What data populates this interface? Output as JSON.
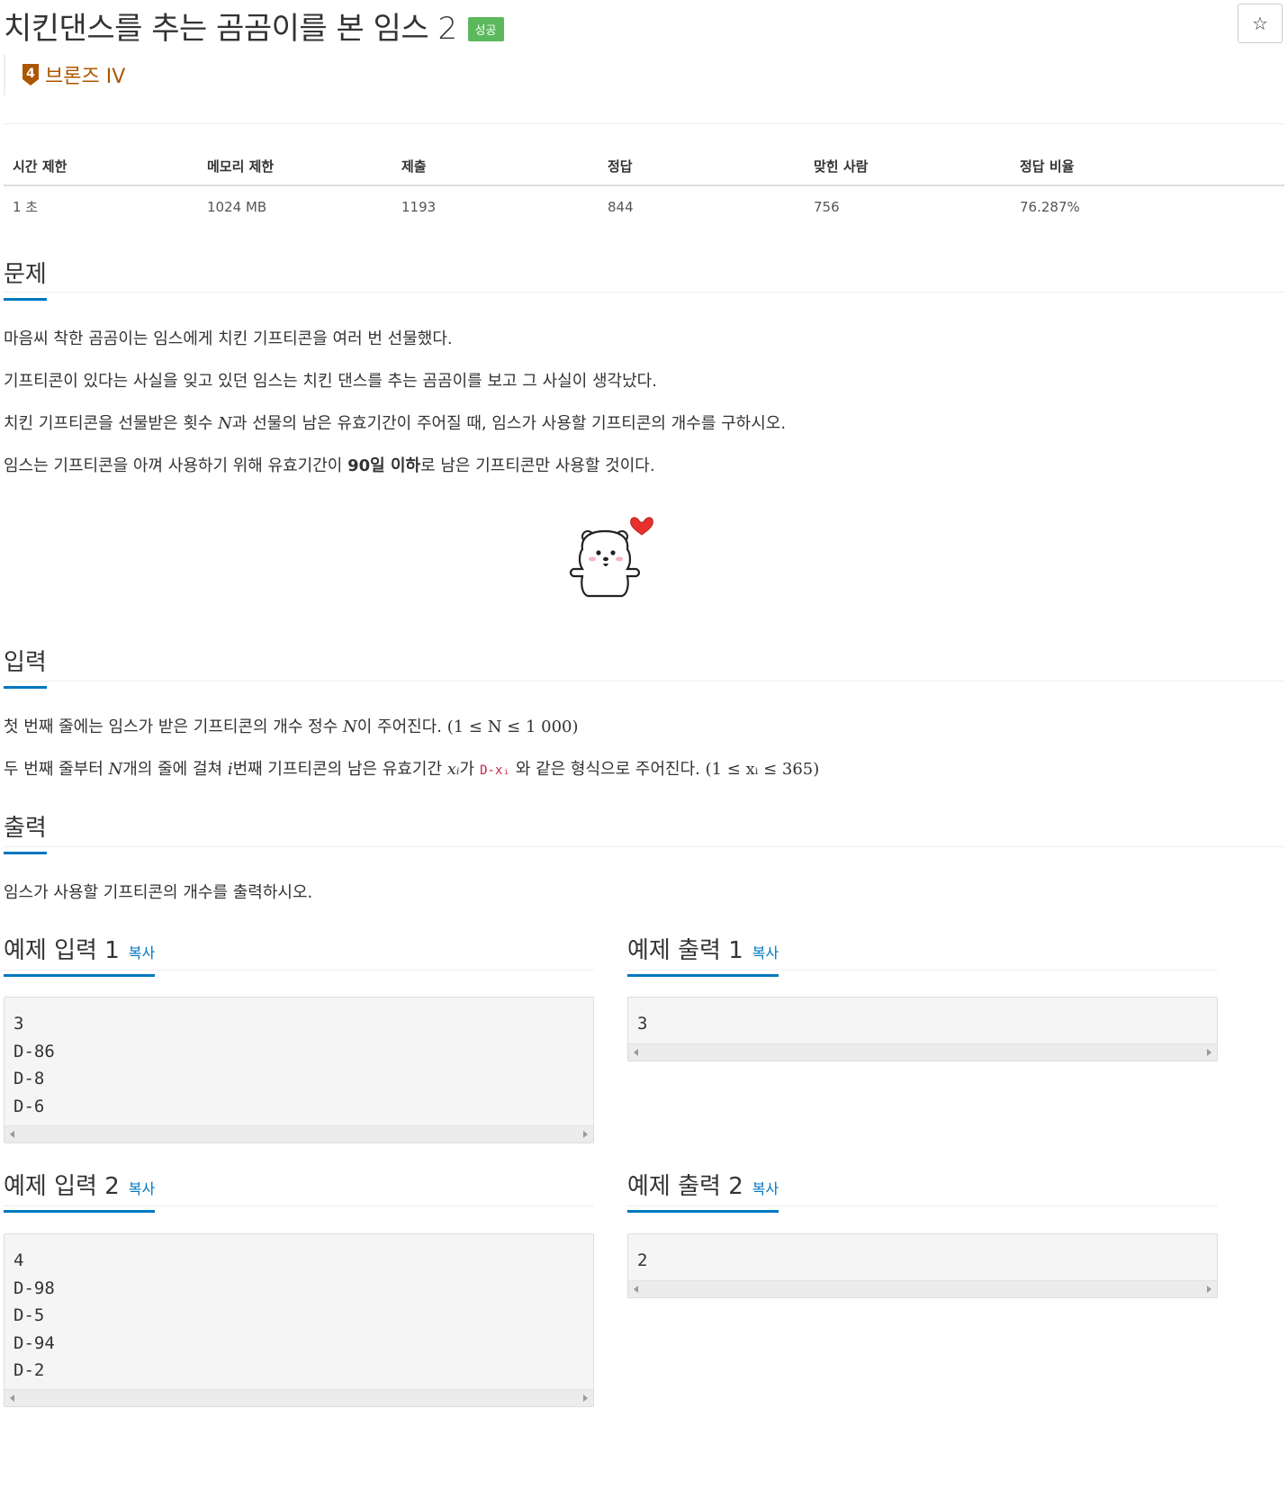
{
  "title": "치킨댄스를 추는 곰곰이를 본 임스 2",
  "result_badge": "성공",
  "star_glyph": "☆",
  "tier": {
    "level": "4",
    "label": "브론즈 IV",
    "color": "#ad5600"
  },
  "info_table": {
    "headers": [
      "시간 제한",
      "메모리 제한",
      "제출",
      "정답",
      "맞힌 사람",
      "정답 비율"
    ],
    "values": [
      "1 초",
      "1024 MB",
      "1193",
      "844",
      "756",
      "76.287%"
    ]
  },
  "problem": {
    "heading": "문제",
    "lines": [
      "마음씨 착한 곰곰이는 임스에게 치킨 기프티콘을 여러 번 선물했다.",
      "기프티콘이 있다는 사실을 잊고 있던 임스는 치킨 댄스를 추는 곰곰이를 보고 그 사실이 생각났다."
    ],
    "line3_a": "치킨 기프티콘을 선물받은 횟수 ",
    "line3_var": "N",
    "line3_b": "과 선물의 남은 유효기간이 주어질 때, 임스가 사용할 기프티콘의 개수를 구하시오.",
    "line4_a": "임스는 기프티콘을 아껴 사용하기 위해 유효기간이 ",
    "line4_bold": "90일 이하",
    "line4_b": "로 남은 기프티콘만 사용할 것이다."
  },
  "input": {
    "heading": "입력",
    "l1_a": "첫 번째 줄에는 임스가 받은 기프티콘의 개수 정수 ",
    "l1_var": "N",
    "l1_b": "이 주어진다. ",
    "l1_math": "(1 ≤ N ≤ 1 000)",
    "l2_a": "두 번째 줄부터 ",
    "l2_var1": "N",
    "l2_b": "개의 줄에 걸쳐 ",
    "l2_var2": "i",
    "l2_c": "번째 기프티콘의 남은 유효기간 ",
    "l2_var3": "xᵢ",
    "l2_d": "가",
    "l2_code": "D-xᵢ",
    "l2_e": "와 같은 형식으로 주어진다. ",
    "l2_math": "(1 ≤ xᵢ ≤ 365)"
  },
  "output": {
    "heading": "출력",
    "text": "임스가 사용할 기프티콘의 개수를 출력하시오."
  },
  "samples": {
    "copy_label": "복사",
    "in1": {
      "heading": "예제 입력 1",
      "lines": [
        "3",
        "D-86",
        "D-8",
        "D-6"
      ]
    },
    "out1": {
      "heading": "예제 출력 1",
      "lines": [
        "3"
      ]
    },
    "in2": {
      "heading": "예제 입력 2",
      "lines": [
        "4",
        "D-98",
        "D-5",
        "D-94",
        "D-2"
      ]
    },
    "out2": {
      "heading": "예제 출력 2",
      "lines": [
        "2"
      ]
    }
  },
  "colors": {
    "accent": "#0076c0",
    "success": "#5cb85c",
    "code": "#c7254e"
  }
}
